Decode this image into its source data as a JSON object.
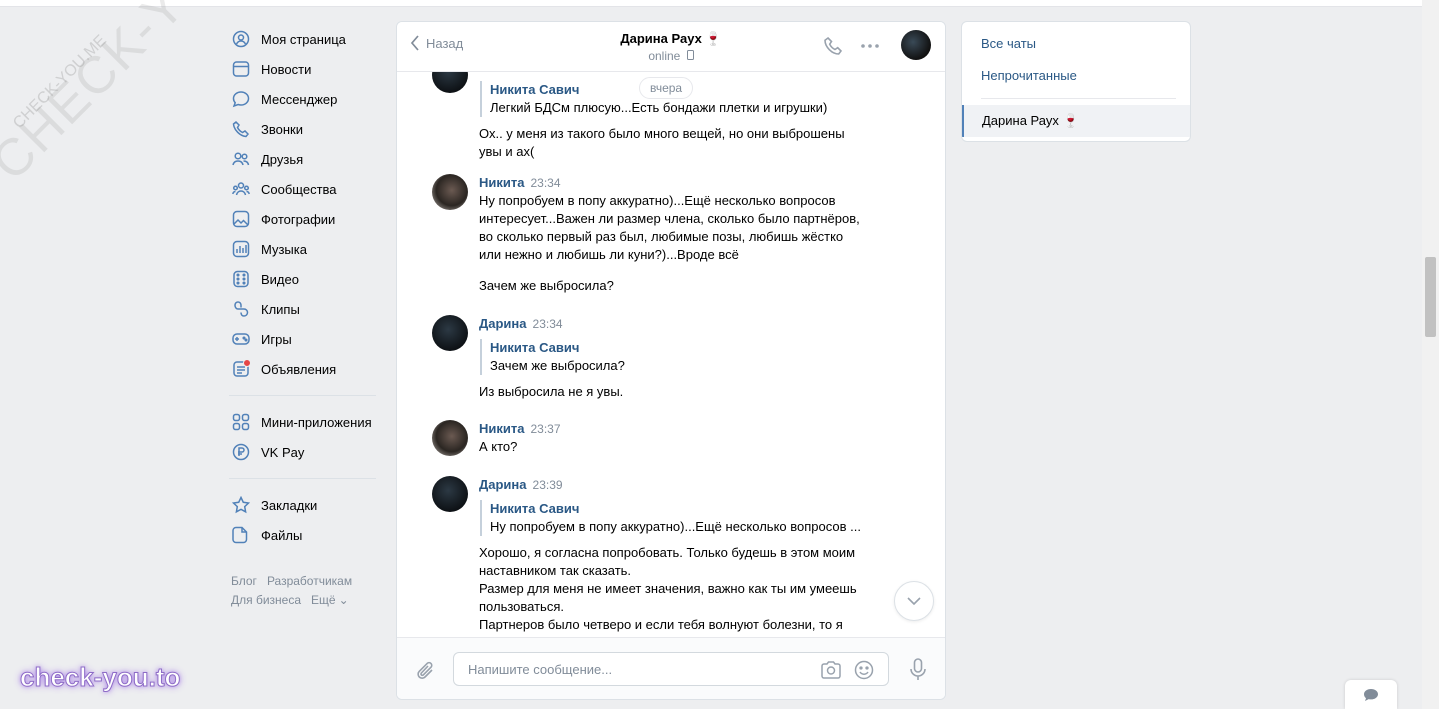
{
  "nav": {
    "items": [
      {
        "label": "Моя страница",
        "icon": "profile-icon"
      },
      {
        "label": "Новости",
        "icon": "news-icon"
      },
      {
        "label": "Мессенджер",
        "icon": "messenger-icon"
      },
      {
        "label": "Звонки",
        "icon": "phone-icon"
      },
      {
        "label": "Друзья",
        "icon": "friends-icon"
      },
      {
        "label": "Сообщества",
        "icon": "communities-icon"
      },
      {
        "label": "Фотографии",
        "icon": "photos-icon"
      },
      {
        "label": "Музыка",
        "icon": "music-icon"
      },
      {
        "label": "Видео",
        "icon": "video-icon"
      },
      {
        "label": "Клипы",
        "icon": "clips-icon"
      },
      {
        "label": "Игры",
        "icon": "games-icon"
      },
      {
        "label": "Объявления",
        "icon": "classifieds-icon"
      }
    ],
    "items2": [
      {
        "label": "Мини-приложения",
        "icon": "mini-apps-icon"
      },
      {
        "label": "VK Pay",
        "icon": "vkpay-icon"
      }
    ],
    "items3": [
      {
        "label": "Закладки",
        "icon": "bookmarks-icon"
      },
      {
        "label": "Файлы",
        "icon": "files-icon"
      }
    ],
    "footer": {
      "blog": "Блог",
      "developers": "Разработчикам",
      "business": "Для бизнеса",
      "more": "Ещё"
    }
  },
  "chat": {
    "back_label": "Назад",
    "title": "Дарина Раух 🍷",
    "status": "online",
    "date_pill": "вчера",
    "messages": [
      {
        "quote_author": "Никита Савич",
        "quote_text": "Легкий БДСм плюсую...Есть бондажи плетки и игрушки)",
        "text": "Ох.. у меня из такого было много вещей, но они выброшены\nувы и ах("
      },
      {
        "author": "Никита",
        "time": "23:34",
        "text": "Ну попробуем в попу аккуратно)...Ещё несколько вопросов\nинтересует...Важен ли размер члена, сколько было партнёров,\nво сколько первый раз был, любимые позы, любишь жёстко\nили нежно и любишь ли куни?)...Вроде всё",
        "text2": "Зачем же выбросила?"
      },
      {
        "author": "Дарина",
        "time": "23:34",
        "quote_author": "Никита Савич",
        "quote_text": "Зачем же выбросила?",
        "text": "Из выбросила не я увы."
      },
      {
        "author": "Никита",
        "time": "23:37",
        "text": "А кто?"
      },
      {
        "author": "Дарина",
        "time": "23:39",
        "quote_author": "Никита Савич",
        "quote_text": "Ну попробуем в попу аккуратно)...Ещё несколько вопросов ...",
        "text": "Хорошо, я согласна попробовать. Только будешь в этом моим\nнаставником так сказать.\nРазмер для меня не имеет значения, важно как ты им умеешь\nпользоваться.\nПартнеров было четверо и если тебя волнуют болезни, то я"
      }
    ],
    "composer_placeholder": "Напишите сообщение..."
  },
  "right_panel": {
    "all_chats": "Все чаты",
    "unread": "Непрочитанные",
    "active_chat": "Дарина Раух 🍷"
  },
  "watermarks": {
    "diagonal": "CHECK-YOU.ME",
    "diagonal_small": "CHECK-YOU.ME",
    "bottom": "check-you.to"
  },
  "colors": {
    "background": "#edeef0",
    "link": "#2a5885",
    "muted": "#818c99",
    "accent": "#5181b8"
  }
}
